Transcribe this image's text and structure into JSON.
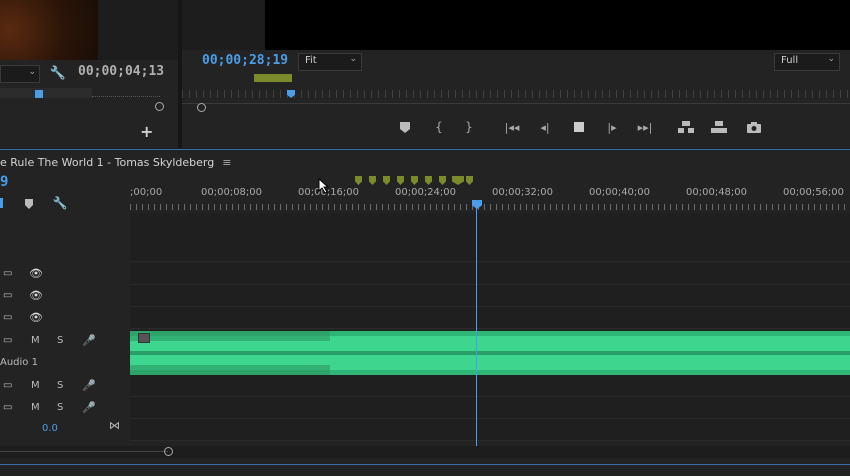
{
  "source_panel": {
    "dropdown_value": "",
    "timecode": "00;00;04;13"
  },
  "program_panel": {
    "timecode": "00;00;28;19",
    "fit_select": "Fit",
    "quality_select": "Full"
  },
  "transport": {
    "buttons": [
      "add-marker",
      "mark-in",
      "mark-out",
      "go-to-in",
      "step-back",
      "stop",
      "step-forward",
      "go-to-out",
      "lift",
      "extract",
      "export-frame"
    ]
  },
  "sequence": {
    "title": "e Rule The World 1 - Tomas Skyldeberg",
    "menu_icon": "hamburger-icon",
    "playhead_timecode": "9",
    "ruler_labels": [
      ";00;00",
      "00;00;08;00",
      "00;00;16;00",
      "00;00;24;00",
      "00;00;32;00",
      "00;00;40;00",
      "00;00;48;00",
      "00;00;56;00"
    ]
  },
  "tracks": {
    "audio_label": "Audio 1",
    "mute_label": "M",
    "solo_label": "S",
    "master_value": "0.0"
  },
  "colors": {
    "accent": "#4a9de8",
    "waveform": "#3ed68f",
    "marker": "#7b8a2a"
  }
}
